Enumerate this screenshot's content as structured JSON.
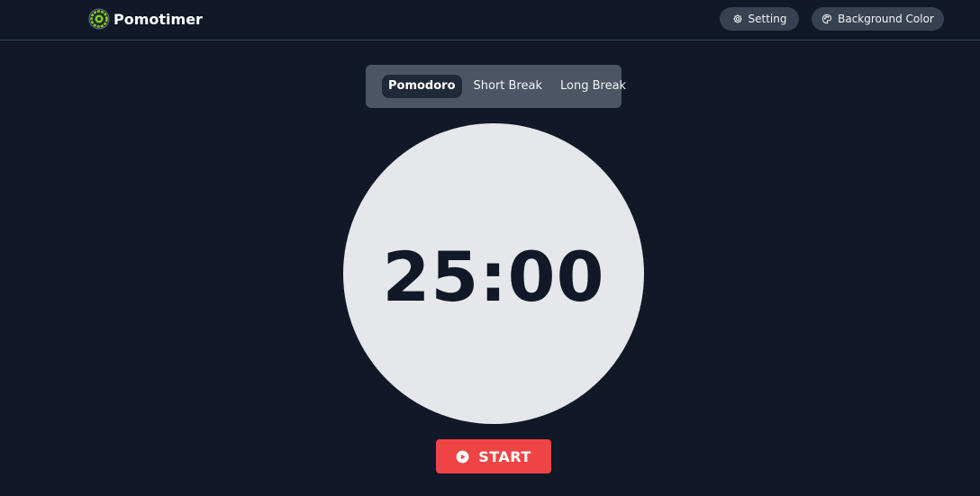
{
  "header": {
    "app_name": "Pomotimer",
    "logo_icon": "pomodoro-target-icon",
    "setting_label": "Setting",
    "setting_icon": "gear-icon",
    "background_label": "Background Color",
    "background_icon": "palette-icon"
  },
  "modes": {
    "tabs": [
      {
        "label": "Pomodoro",
        "active": true
      },
      {
        "label": "Short Break",
        "active": false
      },
      {
        "label": "Long Break",
        "active": false
      }
    ]
  },
  "timer": {
    "display": "25:00"
  },
  "controls": {
    "start_label": "START",
    "start_icon": "play-circle-icon"
  },
  "colors": {
    "background": "#111827",
    "timer_face": "#e5e7eb",
    "accent": "#ef4444",
    "logo": "#84cc16"
  }
}
